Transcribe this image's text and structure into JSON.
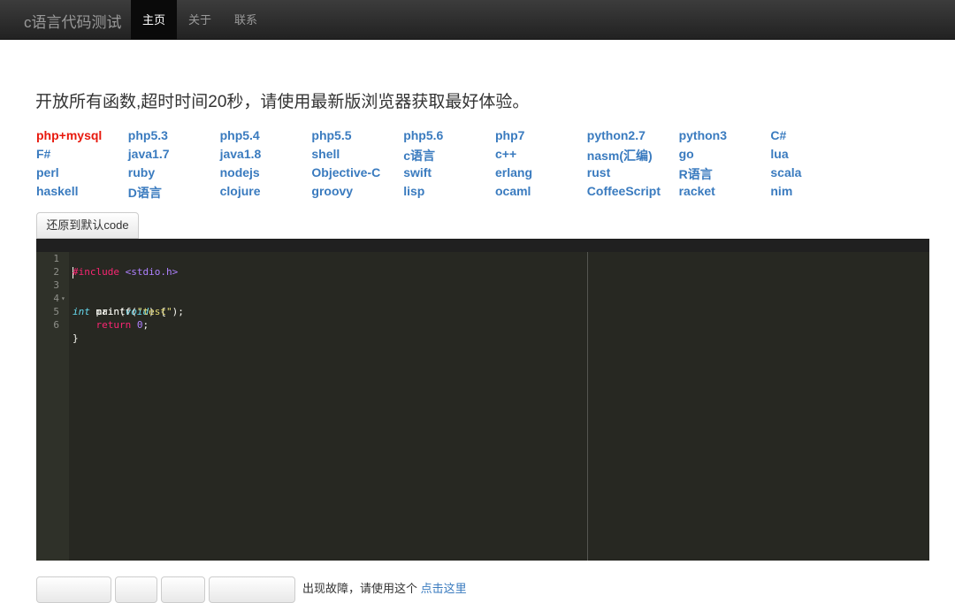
{
  "navbar": {
    "brand": "c语言代码测试",
    "items": [
      {
        "label": "主页",
        "active": true
      },
      {
        "label": "关于",
        "active": false
      },
      {
        "label": "联系",
        "active": false
      }
    ]
  },
  "notice": "开放所有函数,超时时间20秒，请使用最新版浏览器获取最好体验。",
  "languages": [
    "php+mysql",
    "php5.3",
    "php5.4",
    "php5.5",
    "php5.6",
    "php7",
    "python2.7",
    "python3",
    "C#",
    "F#",
    "java1.7",
    "java1.8",
    "shell",
    "c语言",
    "c++",
    "nasm(汇编)",
    "go",
    "lua",
    "perl",
    "ruby",
    "nodejs",
    "Objective-C",
    "swift",
    "erlang",
    "rust",
    "R语言",
    "scala",
    "haskell",
    "D语言",
    "clojure",
    "groovy",
    "lisp",
    "ocaml",
    "CoffeeScript",
    "racket",
    "nim"
  ],
  "active_language": "php+mysql",
  "colors": {
    "link": "#3a7bbf",
    "active_link": "#e8190d",
    "editor_bg": "#272822"
  },
  "reset_button": "还原到默认code",
  "editor": {
    "line_numbers": [
      "1",
      "2",
      "3",
      "4",
      "5",
      "6"
    ],
    "lines": [
      "#include <stdio.h>",
      "",
      "int main(void) {",
      "    printf(\"test\");",
      "    return 0;",
      "}"
    ]
  },
  "bottom": {
    "buttons": [
      "",
      "",
      "",
      ""
    ],
    "tip_text": "出现故障，请使用这个",
    "tip_link": "点击这里"
  }
}
